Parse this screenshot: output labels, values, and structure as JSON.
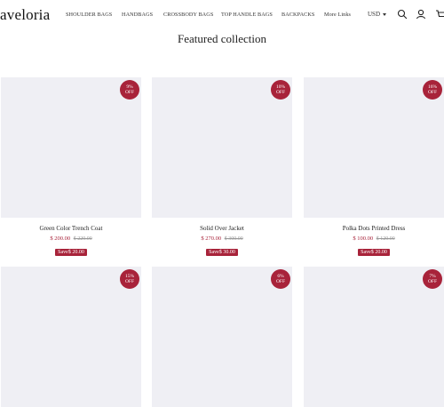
{
  "header": {
    "logo": "aveloria",
    "nav": [
      {
        "label": "SHOULDER BAGS"
      },
      {
        "label": "HANDBAGS"
      },
      {
        "label": "CROSSBODY BAGS"
      },
      {
        "label": "TOP HANDLE BAGS"
      },
      {
        "label": "BACKPACKS"
      },
      {
        "label": "More Links"
      }
    ],
    "currency": "USD",
    "icons": [
      "search-icon",
      "account-icon",
      "cart-icon"
    ]
  },
  "section": {
    "title": "Featured collection"
  },
  "colors": {
    "accent": "#a8233a",
    "image_placeholder": "#efeff4"
  },
  "products": [
    {
      "discount_pct": "9%",
      "discount_label": "OFF",
      "title": "Green Color Trench Coat",
      "price": "$ 200.00",
      "compare": "$ 220.00",
      "save": "Save$ 20.00"
    },
    {
      "discount_pct": "10%",
      "discount_label": "OFF",
      "title": "Solid Over Jacket",
      "price": "$ 270.00",
      "compare": "$ 300.00",
      "save": "Save$ 30.00"
    },
    {
      "discount_pct": "16%",
      "discount_label": "OFF",
      "title": "Polka Dots Printed Dress",
      "price": "$ 100.00",
      "compare": "$ 120.00",
      "save": "Save$ 20.00"
    },
    {
      "discount_pct": "15%",
      "discount_label": "OFF"
    },
    {
      "discount_pct": "6%",
      "discount_label": "OFF"
    },
    {
      "discount_pct": "7%",
      "discount_label": "OFF"
    }
  ]
}
